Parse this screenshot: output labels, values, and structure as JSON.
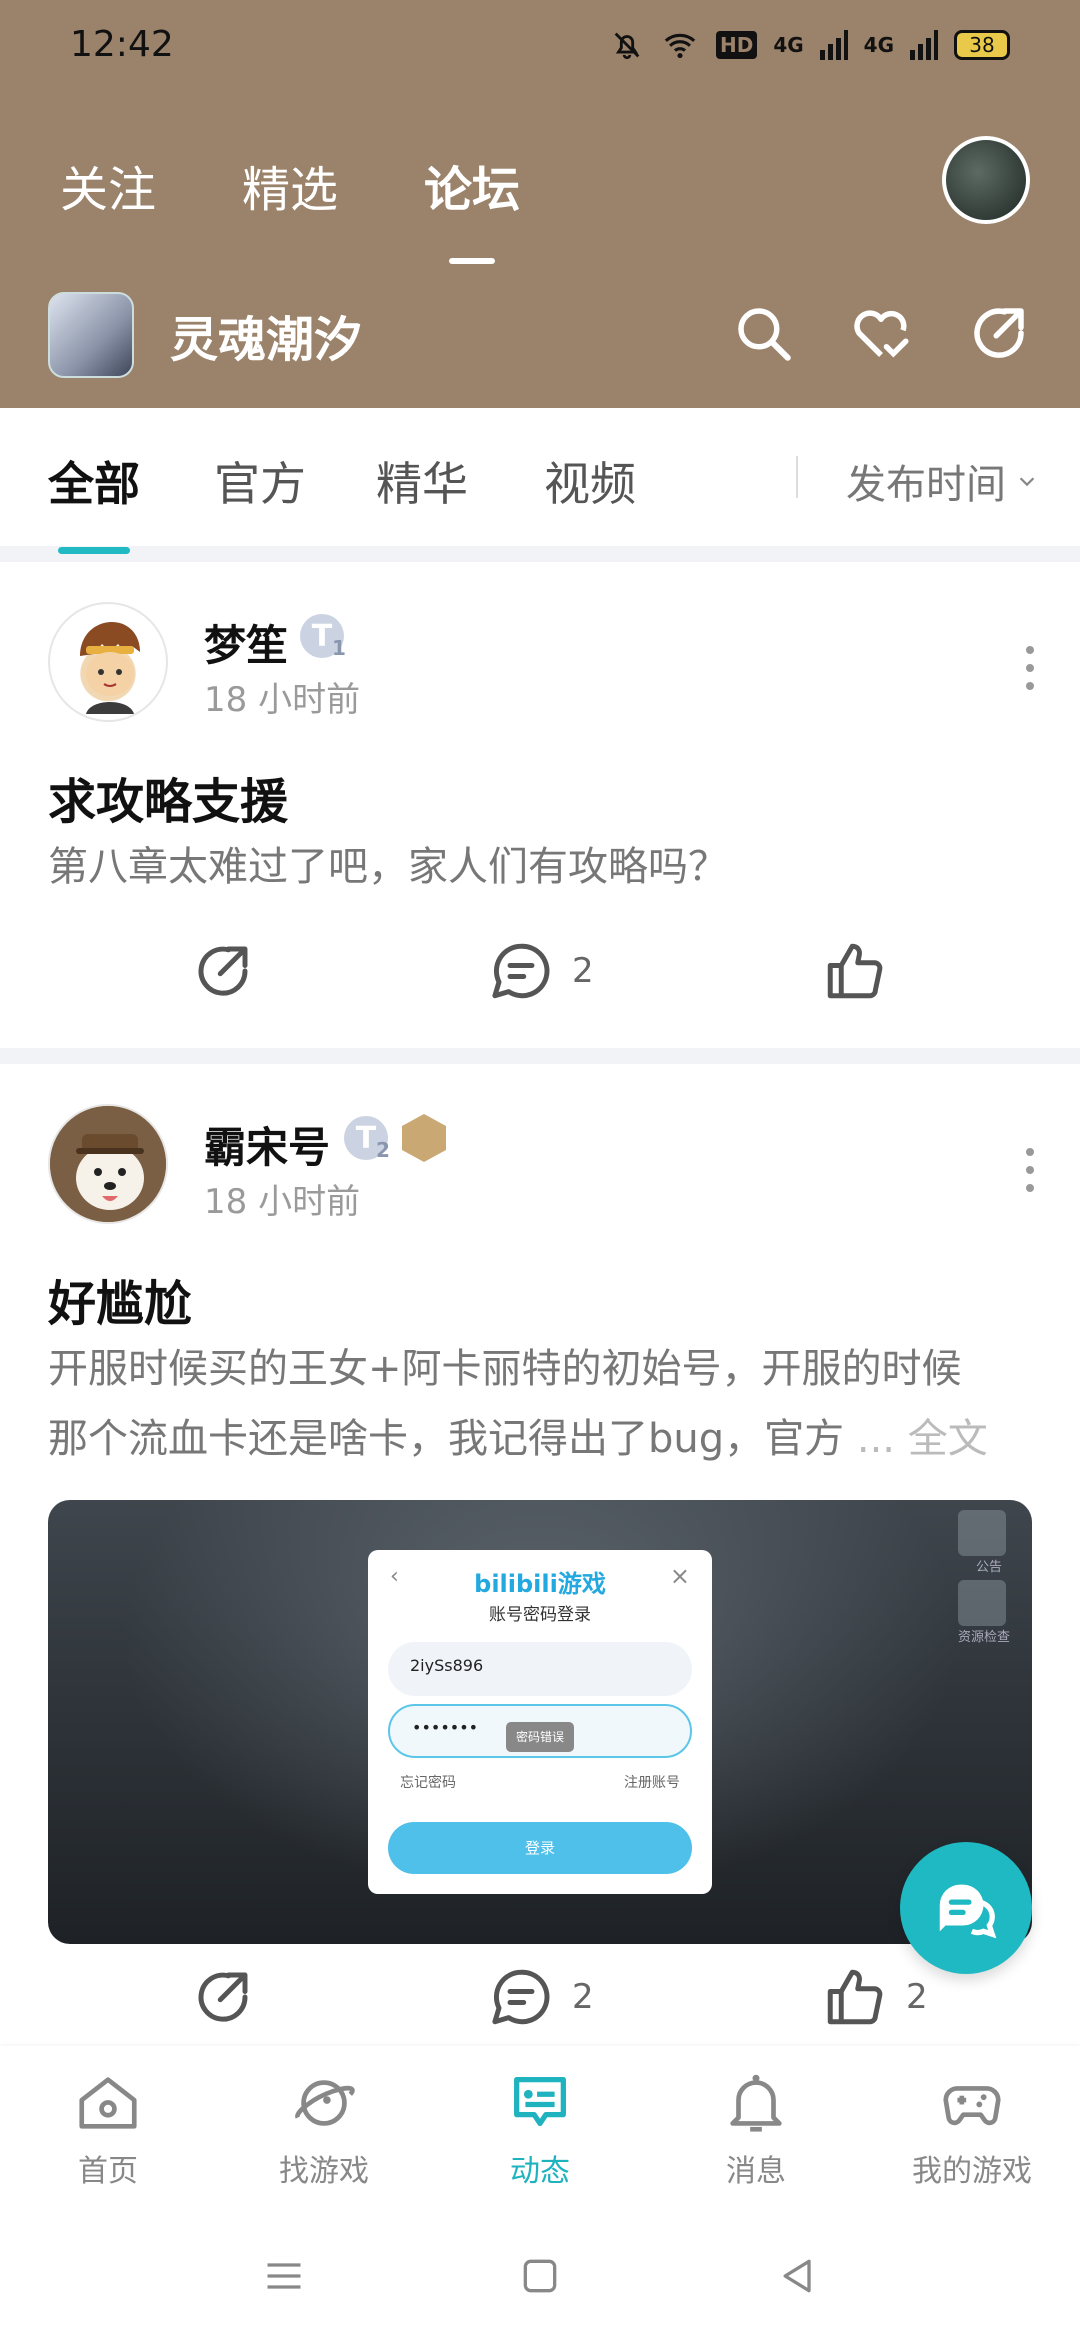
{
  "status_bar": {
    "time": "12:42",
    "battery": "38",
    "network_labels": [
      "HD",
      "4G",
      "4G"
    ]
  },
  "top_tabs": [
    {
      "label": "关注"
    },
    {
      "label": "精选"
    },
    {
      "label": "论坛"
    }
  ],
  "game": {
    "name": "灵魂潮汐"
  },
  "header_icons": [
    "search-icon",
    "heart-check-icon",
    "share-icon"
  ],
  "filter_tabs": [
    {
      "label": "全部"
    },
    {
      "label": "官方"
    },
    {
      "label": "精华"
    },
    {
      "label": "视频"
    }
  ],
  "sort": {
    "label": "发布时间"
  },
  "posts": [
    {
      "user": "梦笙",
      "level": "T",
      "level_num": "1",
      "time": "18 小时前",
      "title": "求攻略支援",
      "body": "第八章太难过了吧，家人们有攻略吗？",
      "comment_count": "2",
      "like_count": ""
    },
    {
      "user": "霸宋号",
      "level": "T",
      "level_num": "2",
      "time": "18 小时前",
      "title": "好尴尬",
      "body_line1": "开服时候买的王女+阿卡丽特的初始号，开服的时候",
      "body_line2": "那个流血卡还是啥卡，我记得出了bug，官方",
      "more_label": "... 全文",
      "image": {
        "logo": "bilibili游戏",
        "subtitle": "账号密码登录",
        "account": "2iySs896",
        "password_mask": "•••••••",
        "error": "密码错误",
        "forgot": "忘记密码",
        "register": "注册账号",
        "login_button": "登录",
        "corner_labels": [
          "公告",
          "资源检查"
        ]
      },
      "comment_count": "2",
      "like_count": "2"
    }
  ],
  "bottom_nav": [
    {
      "label": "首页",
      "icon": "home-icon"
    },
    {
      "label": "找游戏",
      "icon": "planet-icon"
    },
    {
      "label": "动态",
      "icon": "feed-icon",
      "active": true
    },
    {
      "label": "消息",
      "icon": "bell-icon"
    },
    {
      "label": "我的游戏",
      "icon": "gamepad-icon"
    }
  ],
  "colors": {
    "header": "#9b826a",
    "accent": "#1fb9c3"
  }
}
